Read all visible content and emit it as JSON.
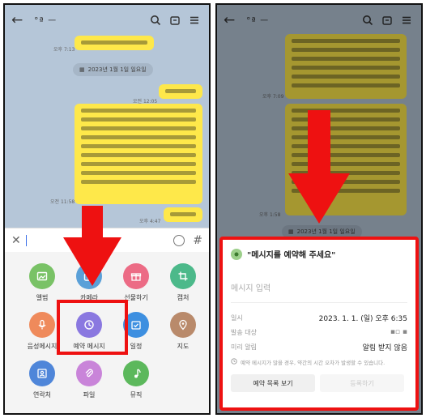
{
  "left": {
    "header": {
      "title": "°ª ㅡ"
    },
    "timestamps": {
      "t1": "오후 7:13",
      "t2": "오전 12:05",
      "t3": "오전 11:58",
      "t4": "오후 4:47"
    },
    "date_pill": "2023년 1월 1일 일요일",
    "attach_items": [
      {
        "label": "앨범",
        "icon": "album-icon",
        "color": "#79c266"
      },
      {
        "label": "카메라",
        "icon": "camera-icon",
        "color": "#5aa0d8"
      },
      {
        "label": "선물하기",
        "icon": "gift-icon",
        "color": "#ec6b85"
      },
      {
        "label": "캡처",
        "icon": "capture-icon",
        "color": "#4cb98a"
      },
      {
        "label": "음성메시지",
        "icon": "mic-icon",
        "color": "#ef8a5b"
      },
      {
        "label": "예약 메시지",
        "icon": "clock-icon",
        "color": "#8a78e0"
      },
      {
        "label": "일정",
        "icon": "calendar-icon",
        "color": "#3d8fe0"
      },
      {
        "label": "지도",
        "icon": "map-pin-icon",
        "color": "#b98a6b"
      },
      {
        "label": "연락처",
        "icon": "contact-icon",
        "color": "#4f86d9"
      },
      {
        "label": "파일",
        "icon": "clip-icon",
        "color": "#c984d9"
      },
      {
        "label": "뮤직",
        "icon": "music-icon",
        "color": "#5cb85c"
      }
    ]
  },
  "right": {
    "date_pill": "2023년 1월 1일 일요일",
    "timestamps": {
      "t1": "오후 7:09",
      "t2": "오후 1:58"
    },
    "sheet": {
      "title": "\"메시지를 예약해 주세요\"",
      "placeholder": "메시지 입력",
      "rows": [
        {
          "key": "일시",
          "value": "2023. 1. 1. (일) 오후 6:35"
        },
        {
          "key": "발송 대상",
          "value": "▪▫ ▪"
        },
        {
          "key": "미리 알림",
          "value": "알림 받지 않음"
        }
      ],
      "notice": "예약 메시지가 많을 경우, 약간의 시간 오차가 발생할 수 있습니다.",
      "btn_list": "예약 목록 보기",
      "btn_register": "등록하기"
    }
  },
  "colors": {
    "accent_red": "#ee1111",
    "bubble": "#fee84a",
    "chat_bg": "#b5c6d8"
  }
}
